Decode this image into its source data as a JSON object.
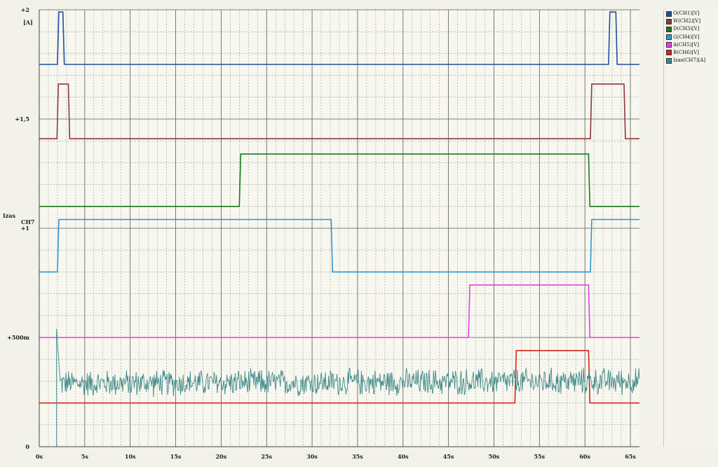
{
  "chart_data": {
    "type": "line",
    "x_unit": "s",
    "xlim": [
      0,
      66
    ],
    "ylim": [
      0,
      2
    ],
    "x_ticks": [
      {
        "value": 0,
        "label": "0s"
      },
      {
        "value": 5,
        "label": "5s"
      },
      {
        "value": 10,
        "label": "10s"
      },
      {
        "value": 15,
        "label": "15s"
      },
      {
        "value": 20,
        "label": "20s"
      },
      {
        "value": 25,
        "label": "25s"
      },
      {
        "value": 30,
        "label": "30s"
      },
      {
        "value": 35,
        "label": "35s"
      },
      {
        "value": 40,
        "label": "40s"
      },
      {
        "value": 45,
        "label": "45s"
      },
      {
        "value": 50,
        "label": "50s"
      },
      {
        "value": 55,
        "label": "55s"
      },
      {
        "value": 60,
        "label": "60s"
      },
      {
        "value": 65,
        "label": "65s"
      }
    ],
    "y_ticks": [
      {
        "value": 0,
        "label": "0"
      },
      {
        "value": 0.5,
        "label": "+500m"
      },
      {
        "value": 1,
        "label": "+1"
      },
      {
        "value": 1.5,
        "label": "+1,5"
      },
      {
        "value": 2,
        "label": "+2"
      }
    ],
    "y_unit_label": "[A]",
    "y_axis_name": "Izas",
    "y_channel_label": "CH7",
    "grid": true,
    "legend_position": "right",
    "series": [
      {
        "name": "O(CH1)[V]",
        "color": "#1f4e9c",
        "low": 1.75,
        "high": 1.99,
        "pulses": [
          [
            2,
            2.7
          ],
          [
            62.6,
            63.5
          ]
        ]
      },
      {
        "name": "W(CH2)[V]",
        "color": "#8b3a3a",
        "low": 1.41,
        "high": 1.66,
        "pulses": [
          [
            1.95,
            3.3
          ],
          [
            60.6,
            64.4
          ]
        ]
      },
      {
        "name": "D(CH3)[V]",
        "color": "#1a7a1a",
        "low": 1.1,
        "high": 1.34,
        "pulses": [
          [
            22,
            60.5
          ]
        ]
      },
      {
        "name": "G(CH4)[V]",
        "color": "#2e96d0",
        "low": 0.8,
        "high": 1.04,
        "pulses": [
          [
            2,
            32.2
          ],
          [
            60.6,
            66
          ]
        ]
      },
      {
        "name": "A(CH5)[V]",
        "color": "#e63fe6",
        "low": 0.5,
        "high": 0.74,
        "pulses": [
          [
            47.2,
            60.5
          ]
        ]
      },
      {
        "name": "B(CH6)[V]",
        "color": "#d9221a",
        "low": 0.2,
        "high": 0.44,
        "pulses": [
          [
            52.3,
            60.5
          ]
        ]
      },
      {
        "name": "Izas(CH7)[A]",
        "color": "#3f8a8a",
        "type": "noise",
        "start": 1.9,
        "level": 0.29,
        "level_end": 0.3,
        "amplitude": 0.07
      }
    ]
  }
}
